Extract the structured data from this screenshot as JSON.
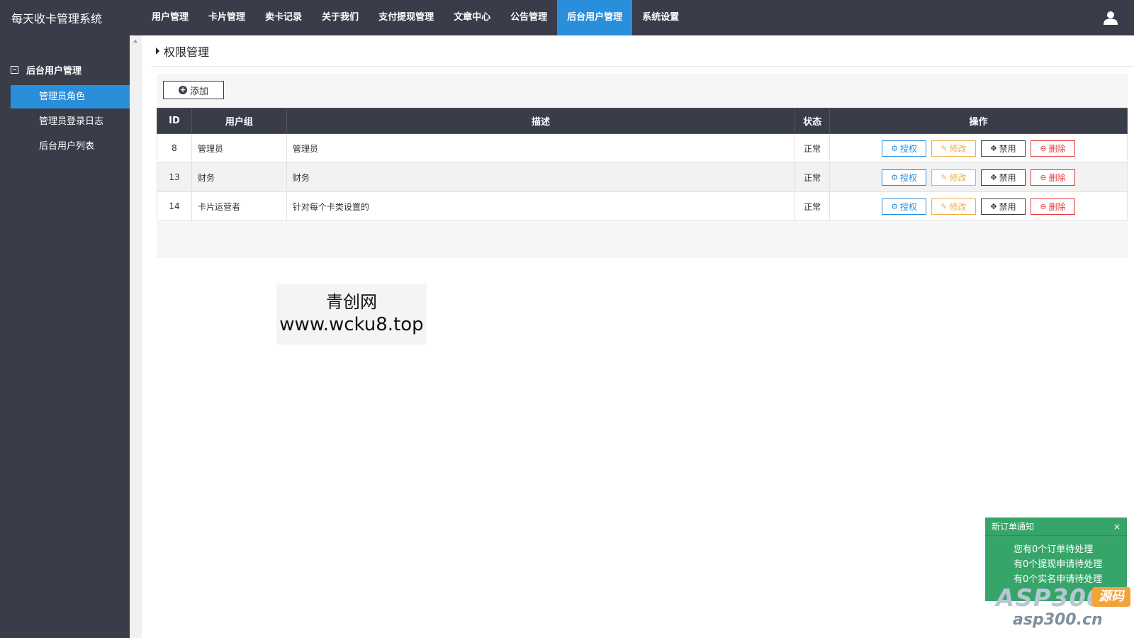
{
  "app": {
    "title": "每天收卡管理系统"
  },
  "topnav": {
    "items": [
      {
        "label": "用户管理"
      },
      {
        "label": "卡片管理"
      },
      {
        "label": "卖卡记录"
      },
      {
        "label": "关于我们"
      },
      {
        "label": "支付提现管理"
      },
      {
        "label": "文章中心"
      },
      {
        "label": "公告管理"
      },
      {
        "label": "后台用户管理"
      },
      {
        "label": "系统设置"
      }
    ],
    "active": "后台用户管理"
  },
  "sidebar": {
    "group_label": "后台用户管理",
    "items": [
      {
        "label": "管理员角色"
      },
      {
        "label": "管理员登录日志"
      },
      {
        "label": "后台用户列表"
      }
    ],
    "active": "管理员角色"
  },
  "page": {
    "title": "权限管理",
    "add_label": "添加"
  },
  "table": {
    "headers": {
      "id": "ID",
      "group": "用户组",
      "desc": "描述",
      "status": "状态",
      "ops": "操作"
    },
    "rows": [
      {
        "id": "8",
        "group": "管理员",
        "desc": "管理员",
        "status": "正常"
      },
      {
        "id": "13",
        "group": "财务",
        "desc": "财务",
        "status": "正常"
      },
      {
        "id": "14",
        "group": "卡片运营者",
        "desc": "针对每个卡类设置的",
        "status": "正常"
      }
    ],
    "actions": {
      "auth": "授权",
      "edit": "修改",
      "ban": "禁用",
      "del": "删除"
    }
  },
  "watermark": {
    "line1": "青创网",
    "line2": "www.wcku8.top"
  },
  "notice": {
    "title": "新订单通知",
    "close": "×",
    "lines": [
      "您有0个订单待处理",
      "有0个提现申请待处理",
      "有0个实名申请待处理"
    ]
  },
  "logo": {
    "main": "ASP300",
    "badge": "源码",
    "sub": "asp300.cn"
  },
  "colors": {
    "dark": "#393D49",
    "accent": "#2A8FDB",
    "notice": "#37A56A",
    "edit": "#F0AD4E",
    "danger": "#E63A3A"
  }
}
